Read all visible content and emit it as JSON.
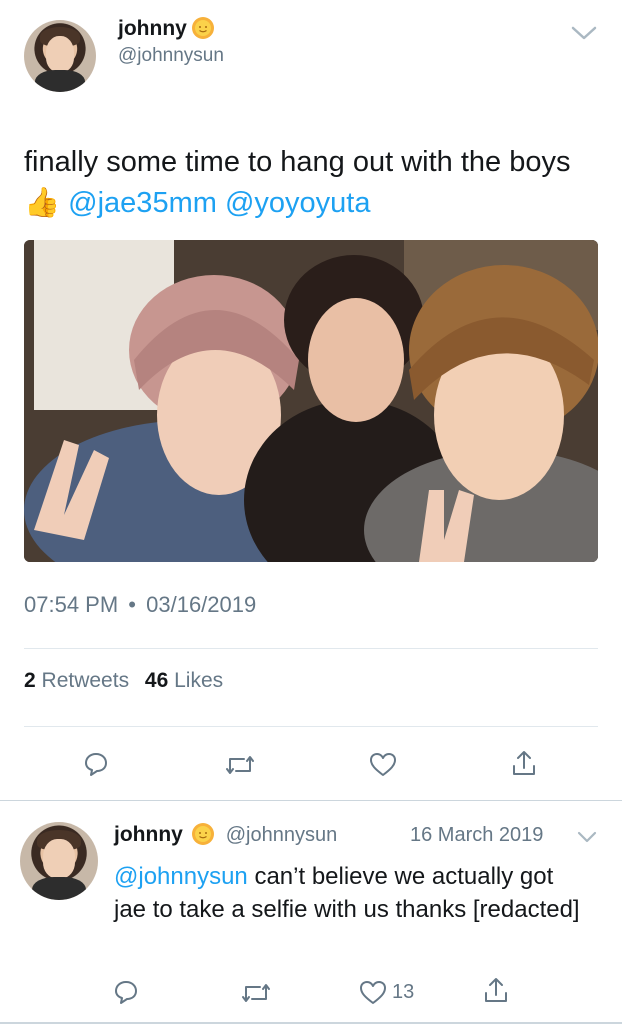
{
  "tweet": {
    "author_name": "johnny",
    "author_handle": "@johnnysun",
    "text_part1": "finally some time to hang out with the boys",
    "emoji": "👍",
    "mention1": "@jae35mm",
    "mention2": "@yoyoyuta",
    "timestamp": "07:54 PM",
    "separator": "•",
    "date": "03/16/2019",
    "retweets_count": "2",
    "retweets_label": "Retweets",
    "likes_count": "46",
    "likes_label": "Likes",
    "photo_icon": "group-selfie-photo"
  },
  "actions": {
    "reply_icon": "reply-icon",
    "retweet_icon": "retweet-icon",
    "like_icon": "heart-icon",
    "share_icon": "share-icon"
  },
  "reply": {
    "author_name": "johnny",
    "author_handle": "@johnnysun",
    "date": "16 March 2019",
    "mention": "@johnnysun",
    "text": " can’t believe we actually got jae to take a selfie with us thanks [redacted]",
    "like_count": "13"
  },
  "colors": {
    "link": "#1da1f2",
    "secondary_text": "#657786",
    "divider": "#e1e8ed"
  }
}
